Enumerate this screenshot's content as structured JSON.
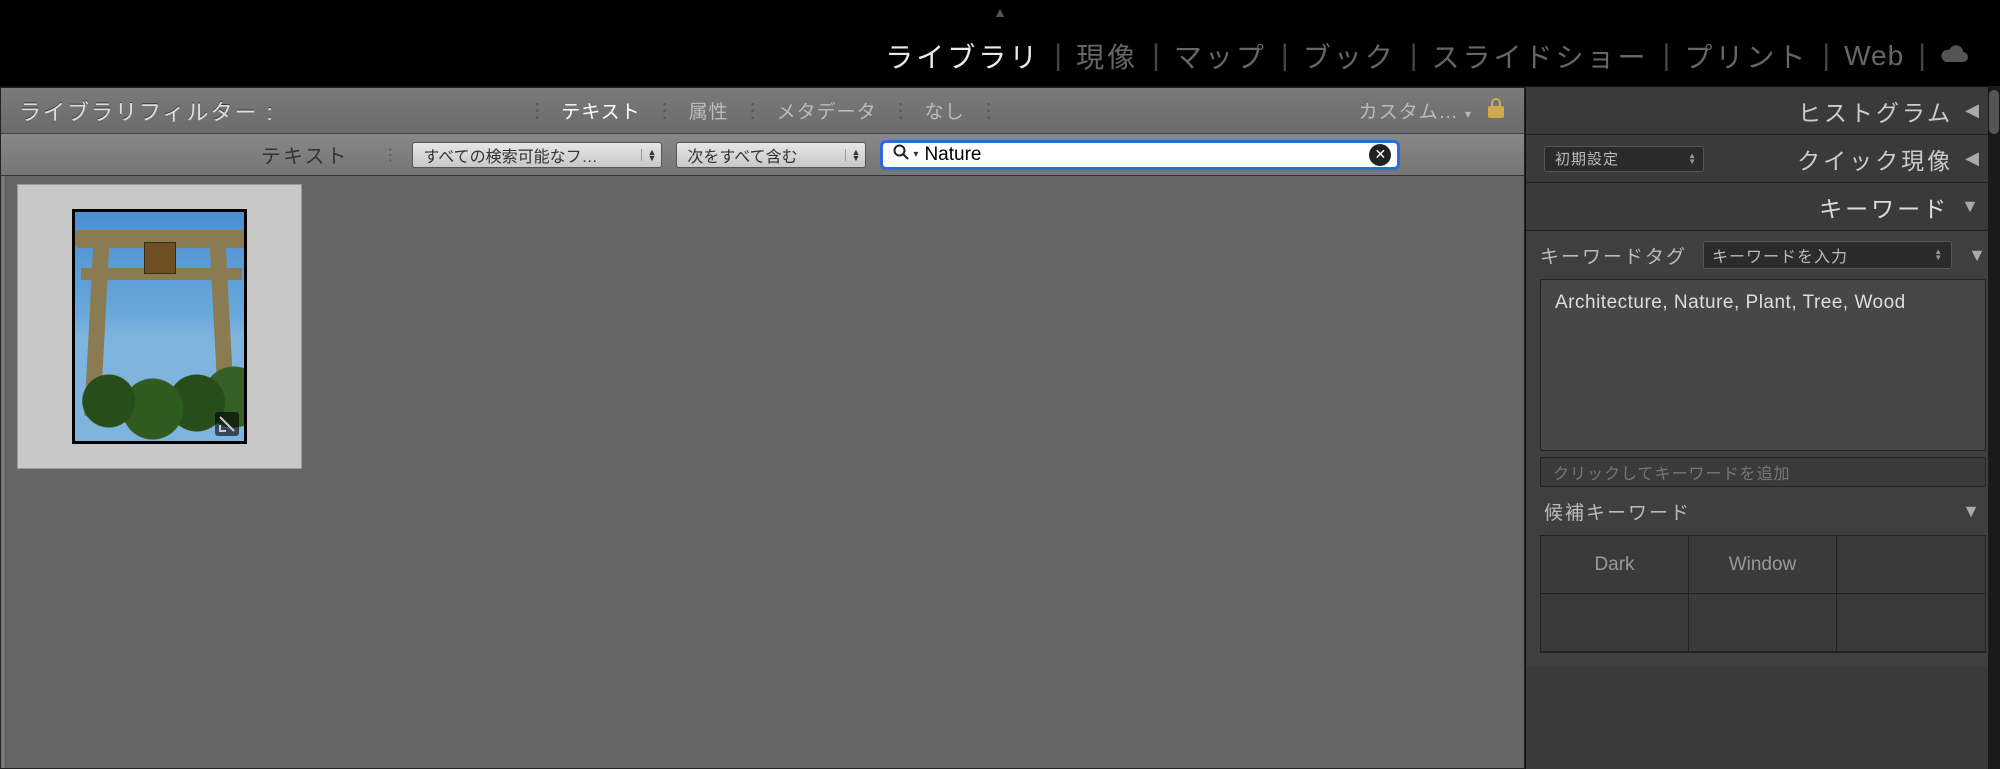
{
  "modules": {
    "library": "ライブラリ",
    "develop": "現像",
    "map": "マップ",
    "book": "ブック",
    "slideshow": "スライドショー",
    "print": "プリント",
    "web": "Web"
  },
  "filter_bar": {
    "title": "ライブラリフィルター :",
    "tabs": {
      "text": "テキスト",
      "attribute": "属性",
      "metadata": "メタデータ",
      "none": "なし"
    },
    "custom": "カスタム…"
  },
  "search_row": {
    "label": "テキスト",
    "field_select": "すべての検索可能なフ…",
    "rule_select": "次をすべて含む",
    "query": "Nature"
  },
  "right": {
    "histogram": "ヒストグラム",
    "quick_develop": "クイック現像",
    "preset": "初期設定",
    "keyword": "キーワード",
    "keyword_tag_label": "キーワードタグ",
    "keyword_tag_select": "キーワードを入力",
    "keywords_value": "Architecture, Nature, Plant, Tree, Wood",
    "keyword_add_placeholder": "クリックしてキーワードを追加",
    "suggest_label": "候補キーワード",
    "suggestions": [
      "Dark",
      "Window",
      "",
      "",
      "",
      ""
    ]
  }
}
